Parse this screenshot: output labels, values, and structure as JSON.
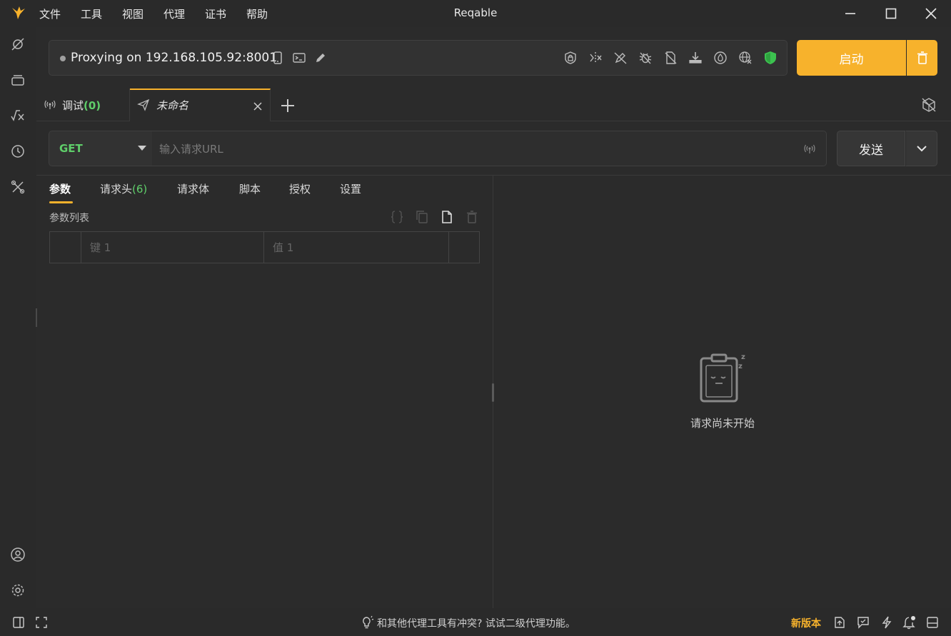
{
  "app": {
    "title": "Reqable",
    "menu": [
      "文件",
      "工具",
      "视图",
      "代理",
      "证书",
      "帮助"
    ]
  },
  "window_controls": [
    "minimize-icon",
    "maximize-icon",
    "close-icon"
  ],
  "activity_bar": {
    "top": [
      "capture-icon",
      "collection-icon",
      "formula-icon",
      "history-icon",
      "tools-icon"
    ],
    "bottom": [
      "account-icon",
      "settings-icon"
    ]
  },
  "proxy": {
    "status_text": "Proxying on 192.168.105.92:8001",
    "status_color": "#a0a0a0",
    "inline_icons": [
      "mobile-icon",
      "terminal-icon",
      "edit-icon"
    ],
    "tool_icons": [
      "ssl-lock-icon",
      "breakpoint-icon",
      "rewrite-off-icon",
      "script-bug-icon",
      "mock-off-icon",
      "download-icon",
      "throttle-icon",
      "network-off-icon",
      "shield-check-icon"
    ],
    "start_label": "启动",
    "accent_color": "#f7b22c"
  },
  "tabs": {
    "debug": {
      "label": "调试",
      "count": "(0)"
    },
    "current": {
      "label": "未命名"
    }
  },
  "request": {
    "method": "GET",
    "method_color": "#5fce6a",
    "url_value": "",
    "url_placeholder": "输入请求URL",
    "send_label": "发送"
  },
  "request_tabs": {
    "params": "参数",
    "headers": "请求头",
    "headers_count": "(6)",
    "body": "请求体",
    "script": "脚本",
    "auth": "授权",
    "settings": "设置"
  },
  "params": {
    "title": "参数列表",
    "key_placeholder": "键 1",
    "value_placeholder": "值 1"
  },
  "response": {
    "empty_text": "请求尚未开始"
  },
  "status_bar": {
    "tip": "和其他代理工具有冲突? 试试二级代理功能。",
    "new_version": "新版本"
  }
}
